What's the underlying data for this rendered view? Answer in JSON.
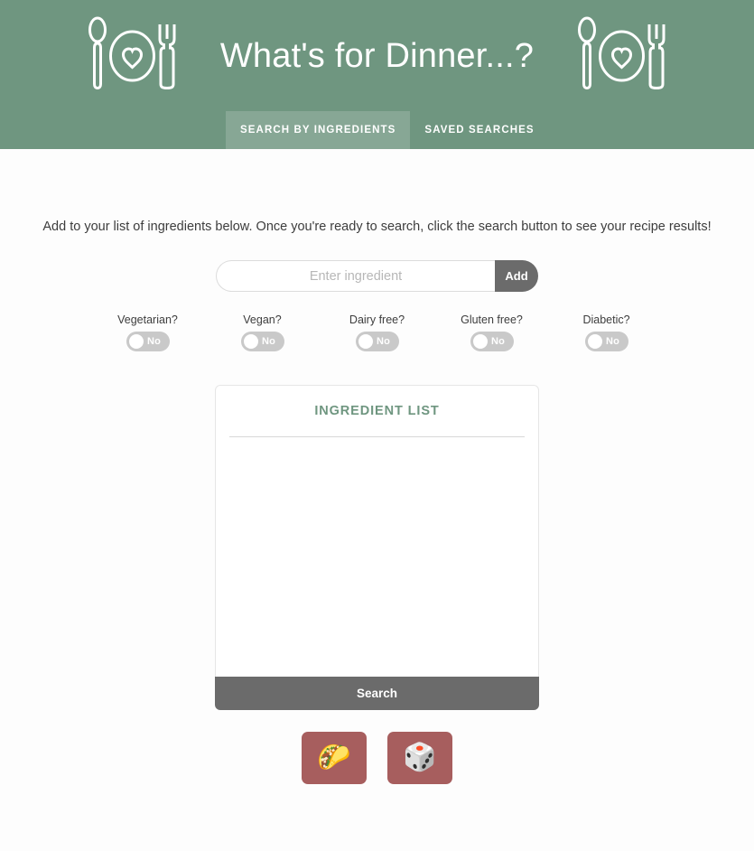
{
  "header": {
    "title": "What's for Dinner...?",
    "background_color": "#6f9680",
    "logo_left_name": "spoon-plate-heart-fork-logo",
    "logo_right_name": "spoon-plate-heart-fork-logo",
    "tabs": [
      {
        "label": "Search by ingredients",
        "active": true
      },
      {
        "label": "Saved searches",
        "active": false
      }
    ]
  },
  "main": {
    "instructions": "Add to your list of ingredients below. Once you're ready to search, click the search button to see your recipe results!",
    "add_row": {
      "input_value": "",
      "input_placeholder": "Enter ingredient",
      "add_label": "Add"
    },
    "filters": [
      {
        "label": "Vegetarian?",
        "state": "No",
        "on": false
      },
      {
        "label": "Vegan?",
        "state": "No",
        "on": false
      },
      {
        "label": "Dairy free?",
        "state": "No",
        "on": false
      },
      {
        "label": "Gluten free?",
        "state": "No",
        "on": false
      },
      {
        "label": "Diabetic?",
        "state": "No",
        "on": false
      }
    ],
    "panel": {
      "title": "Ingredient List",
      "title_color": "#6f9680",
      "items": [],
      "search_label": "Search"
    },
    "icon_buttons": [
      {
        "name": "taco-button",
        "glyph": "🌮"
      },
      {
        "name": "dice-button",
        "glyph": "🎲"
      }
    ]
  }
}
